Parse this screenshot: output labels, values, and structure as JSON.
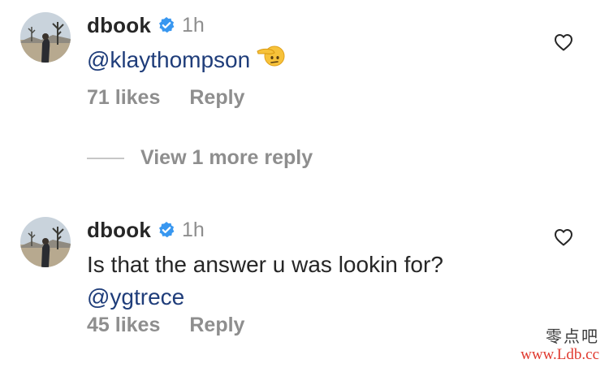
{
  "comments": [
    {
      "username": "dbook",
      "timestamp": "1h",
      "verified": true,
      "avatar_icon": "desert-landscape-avatar",
      "text": "",
      "mention": "@klaythompson",
      "emoji": "saluting-face",
      "likes": "71 likes",
      "reply": "Reply"
    },
    {
      "username": "dbook",
      "timestamp": "1h",
      "verified": true,
      "avatar_icon": "desert-landscape-avatar",
      "text": "Is that the answer u was lookin for?",
      "mention": "@ygtrece",
      "likes": "45 likes",
      "reply": "Reply"
    }
  ],
  "view_replies": "View 1 more reply",
  "watermark": {
    "top": "零点吧",
    "bottom": "www.Ldb.cc"
  },
  "colors": {
    "text": "#262626",
    "secondary": "#8e8e8e",
    "mention": "#1f3d7a",
    "verified": "#3897f0",
    "watermark_red": "#e03a2f"
  }
}
